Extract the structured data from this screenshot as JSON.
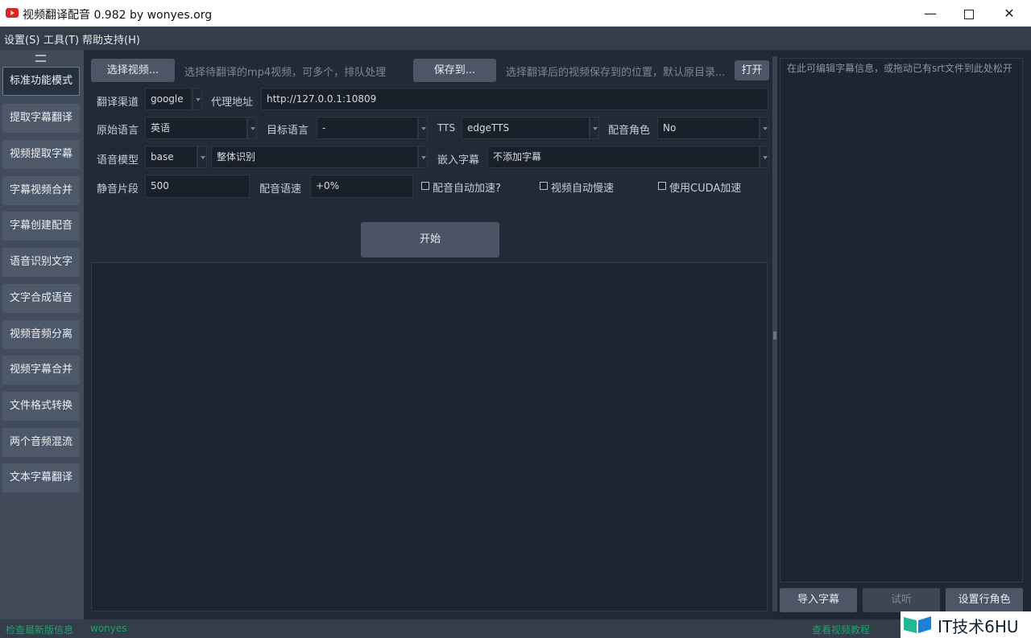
{
  "window": {
    "title": "视频翻译配音 0.982 by wonyes.org",
    "min_icon": "minimize-icon",
    "max_icon": "maximize-icon",
    "close_icon": "close-icon"
  },
  "menu": [
    "设置(S)",
    "工具(T)",
    "帮助支持(H)"
  ],
  "sidebar": {
    "items": [
      "标准功能模式",
      "提取字幕翻译",
      "视频提取字幕",
      "字幕视频合并",
      "字幕创建配音",
      "语音识别文字",
      "文字合成语音",
      "视频音频分离",
      "视频字幕合并",
      "文件格式转换",
      "两个音频混流",
      "文本字幕翻译"
    ],
    "active_index": 0
  },
  "toolbar": {
    "select_video_label": "选择视频...",
    "select_video_hint": "选择待翻译的mp4视频，可多个，排队处理",
    "save_to_label": "保存到...",
    "save_to_hint": "选择翻译后的视频保存到的位置，默认原目录...",
    "open_label": "打开"
  },
  "form": {
    "translate_channel_label": "翻译渠道",
    "translate_channel_value": "google",
    "proxy_label": "代理地址",
    "proxy_value": "http://127.0.0.1:10809",
    "source_lang_label": "原始语言",
    "source_lang_value": "英语",
    "target_lang_label": "目标语言",
    "target_lang_value": "-",
    "tts_label": "TTS",
    "tts_value": "edgeTTS",
    "voice_role_label": "配音角色",
    "voice_role_value": "No",
    "speech_model_label": "语音模型",
    "speech_model_value": "base",
    "recognition_mode_value": "整体识别",
    "embed_subtitle_label": "嵌入字幕",
    "embed_subtitle_value": "不添加字幕",
    "silence_label": "静音片段",
    "silence_value": "500",
    "voice_rate_label": "配音语速",
    "voice_rate_value": "+0%",
    "auto_speedup_label": "配音自动加速?",
    "auto_slowdown_label": "视频自动慢速",
    "cuda_label": "使用CUDA加速"
  },
  "start_label": "开始",
  "editor": {
    "placeholder": "在此可编辑字幕信息，或拖动已有srt文件到此处松开"
  },
  "right_buttons": {
    "import_label": "导入字幕",
    "listen_label": "试听",
    "set_role_label": "设置行角色"
  },
  "status": {
    "left_text": "检查最新版信息",
    "left_link": "wonyes",
    "right_text": "查看视频教程"
  },
  "watermark": {
    "text": "IT技术6HU"
  },
  "colors": {
    "background": "#1f2733",
    "sidebar": "#414b5a",
    "button": "#4c5666",
    "status_green": "#1aa56b",
    "logo_red": "#e0241b"
  }
}
